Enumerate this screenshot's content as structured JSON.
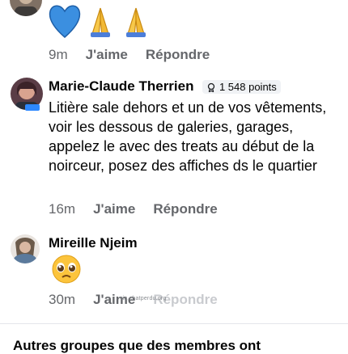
{
  "comments": [
    {
      "reactions_emojis": [
        "💙",
        "🙏"
      ],
      "time": "9m",
      "like_label": "J'aime",
      "reply_label": "Répondre"
    },
    {
      "author": "Marie-Claude Therrien",
      "badge_points": "1 548 points",
      "text": "Litière sale dehors et un de vos vêtements, voir les dessous de galeries, garages, appelez le avec des treats au début de la noirceur, posez des affiches ds le quartier",
      "time": "16m",
      "like_label": "J'aime",
      "reply_label": "Répondre"
    },
    {
      "author": "Mireille Njeim",
      "emoji": "🥺",
      "time": "30m",
      "like_label": "J'aime",
      "reply_label": "Répondre",
      "watermark": "via chatperdu.org"
    }
  ],
  "footer": {
    "text": "Autres groupes que des membres ont"
  },
  "colors": {
    "action_gray": "#65676b",
    "badge_bg": "#f0f2f5",
    "avatar_mc": "#5a3d46",
    "avatar_mn": "#6b5a4a"
  }
}
